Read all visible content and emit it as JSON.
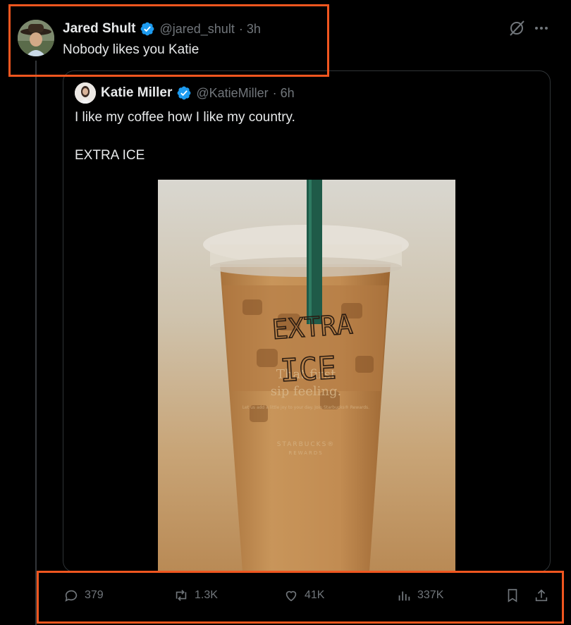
{
  "post": {
    "author_name": "Jared Shult",
    "author_handle": "@jared_shult",
    "time": "· 3h",
    "text": "Nobody likes you Katie"
  },
  "quote": {
    "author_name": "Katie Miller",
    "author_handle": "@KatieMiller",
    "time": "· 6h",
    "text_line1": "I like my coffee how I like my country.",
    "text_line2": "EXTRA ICE",
    "image": {
      "cup_writing_line1": "EXTRA",
      "cup_writing_line2": "ICE",
      "cup_print_line1": "That first",
      "cup_print_line2": "sip feeling.",
      "cup_print_small": "Let us add a little joy to your day. Join Starbucks® Rewards.",
      "brand_line1": "STARBUCKS®",
      "brand_line2": "REWARDS"
    }
  },
  "actions": {
    "replies": "379",
    "reposts": "1.3K",
    "likes": "41K",
    "views": "337K"
  },
  "colors": {
    "background": "#000000",
    "verified_blue": "#1d9bf0",
    "muted": "#71767b",
    "highlight": "#f0561f"
  },
  "icons": [
    "grok-icon",
    "more-icon",
    "reply-icon",
    "repost-icon",
    "like-icon",
    "views-icon",
    "bookmark-icon",
    "share-icon"
  ]
}
